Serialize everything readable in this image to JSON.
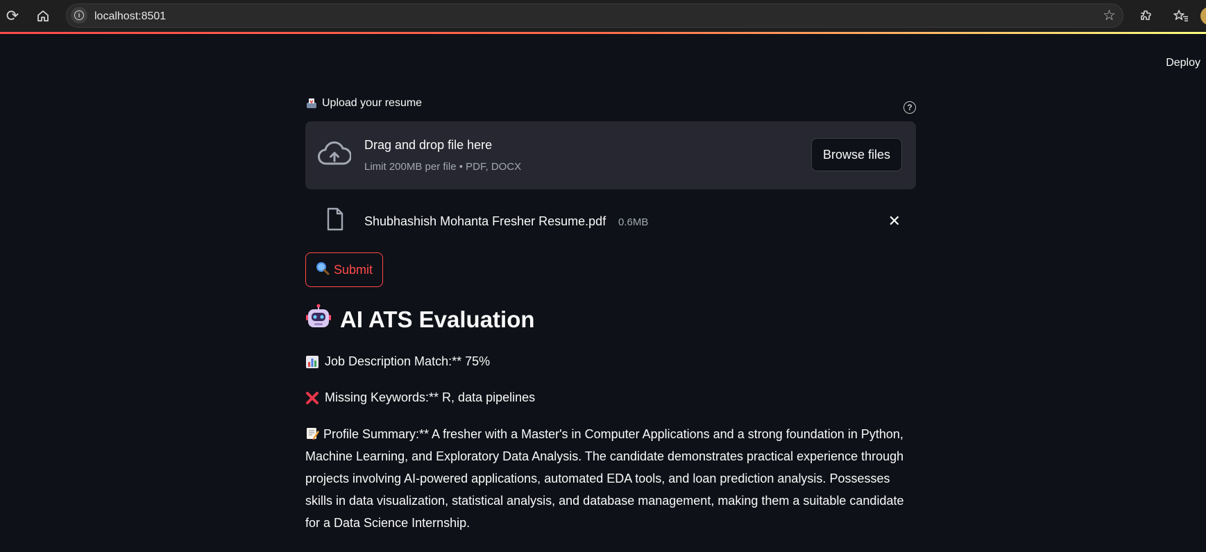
{
  "browser": {
    "url": "localhost:8501"
  },
  "app": {
    "deploy_label": "Deploy",
    "uploader": {
      "label": "Upload your resume",
      "dropzone_title": "Drag and drop file here",
      "dropzone_limit": "Limit 200MB per file • PDF, DOCX",
      "browse_label": "Browse files",
      "file_name": "Shubhashish Mohanta Fresher Resume.pdf",
      "file_size": "0.6MB"
    },
    "submit_label": "Submit",
    "result": {
      "title": "AI ATS Evaluation",
      "match": "Job Description Match:** 75%",
      "missing": "Missing Keywords:** R, data pipelines",
      "summary": "Profile Summary:** A fresher with a Master's in Computer Applications and a strong foundation in Python, Machine Learning, and Exploratory Data Analysis. The candidate demonstrates practical experience through projects involving AI-powered applications, automated EDA tools, and loan prediction analysis. Possesses skills in data visualization, statistical analysis, and database management, making them a suitable candidate for a Data Science Internship."
    }
  },
  "colors": {
    "background": "#0e1117",
    "accent": "#ff4b4b",
    "dropzone": "#262730"
  }
}
